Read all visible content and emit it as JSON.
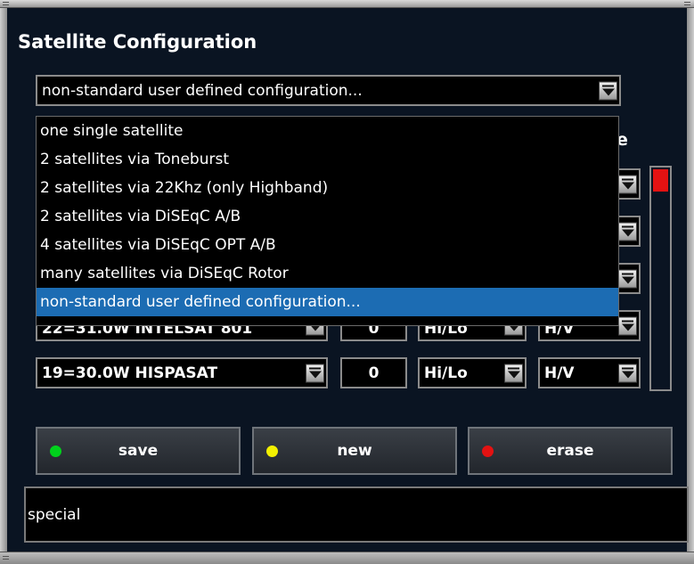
{
  "screen": {
    "title": "Satellite Configuration",
    "mode_select": {
      "value": "non-standard user defined configuration...",
      "options": [
        "one single satellite",
        "2 satellites via Toneburst",
        "2 satellites via 22Khz (only Highband)",
        "2 satellites via DiSEqC A/B",
        "4 satellites via DiSEqC OPT A/B",
        "many satellites via DiSEqC Rotor",
        "non-standard user defined configuration..."
      ],
      "selected_index": 6
    },
    "partial_header": "e",
    "rows": [
      {
        "satellite": "22=31.0W INTELSAT 801",
        "value": "0",
        "band": "Hi/Lo",
        "polarity": "H/V"
      },
      {
        "satellite": "19=30.0W HISPASAT",
        "value": "0",
        "band": "Hi/Lo",
        "polarity": "H/V"
      }
    ],
    "signal_level": 0.1,
    "buttons": {
      "save": {
        "label": "save",
        "color": "#00d21c"
      },
      "new": {
        "label": "new",
        "color": "#f2f000"
      },
      "erase": {
        "label": "erase",
        "color": "#e31212"
      }
    },
    "status_text": "special"
  }
}
